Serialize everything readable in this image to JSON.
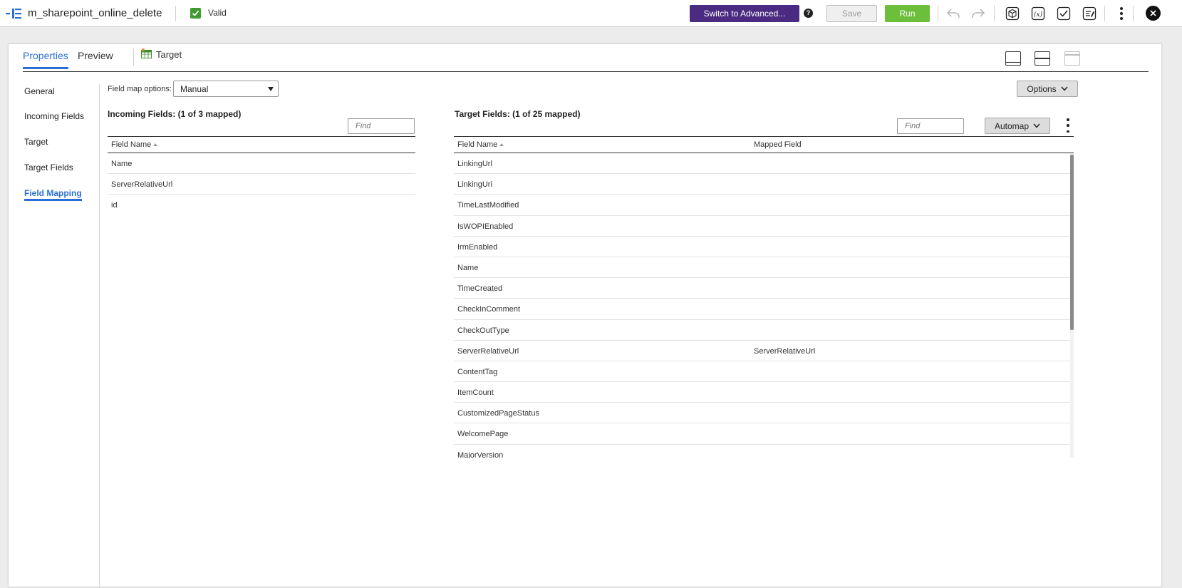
{
  "header": {
    "mapping_name": "m_sharepoint_online_delete",
    "status_label": "Valid",
    "switch_button": "Switch to Advanced...",
    "help": "?",
    "save_button": "Save",
    "run_button": "Run"
  },
  "colors": {
    "accent": "#2a6fd6",
    "advanced": "#4b2a82",
    "run": "#6bbf3a",
    "valid": "#3f9b2f"
  },
  "tabs": [
    {
      "label": "Properties",
      "active": true
    },
    {
      "label": "Preview",
      "active": false
    },
    {
      "label": "Target",
      "icon": "target-table-icon"
    }
  ],
  "sidebar": {
    "items": [
      {
        "label": "General"
      },
      {
        "label": "Incoming Fields"
      },
      {
        "label": "Target"
      },
      {
        "label": "Target Fields"
      },
      {
        "label": "Field Mapping",
        "active": true
      }
    ]
  },
  "field_map": {
    "label": "Field map options:",
    "selected": "Manual",
    "options_button": "Options"
  },
  "incoming": {
    "title": "Incoming Fields: (1 of 3 mapped)",
    "find_placeholder": "Find",
    "col_field_name": "Field Name",
    "rows": [
      "Name",
      "ServerRelativeUrl",
      "id"
    ]
  },
  "target": {
    "title": "Target Fields: (1 of 25 mapped)",
    "find_placeholder": "Find",
    "automap_button": "Automap",
    "col_field_name": "Field Name",
    "col_mapped_field": "Mapped Field",
    "rows": [
      {
        "name": "LinkingUrl",
        "mapped": ""
      },
      {
        "name": "LinkingUri",
        "mapped": ""
      },
      {
        "name": "TimeLastModified",
        "mapped": ""
      },
      {
        "name": "IsWOPIEnabled",
        "mapped": ""
      },
      {
        "name": "IrmEnabled",
        "mapped": ""
      },
      {
        "name": "Name",
        "mapped": ""
      },
      {
        "name": "TimeCreated",
        "mapped": ""
      },
      {
        "name": "CheckInComment",
        "mapped": ""
      },
      {
        "name": "CheckOutType",
        "mapped": ""
      },
      {
        "name": "ServerRelativeUrl",
        "mapped": "ServerRelativeUrl"
      },
      {
        "name": "ContentTag",
        "mapped": ""
      },
      {
        "name": "ItemCount",
        "mapped": ""
      },
      {
        "name": "CustomizedPageStatus",
        "mapped": ""
      },
      {
        "name": "WelcomePage",
        "mapped": ""
      },
      {
        "name": "MajorVersion",
        "mapped": ""
      }
    ]
  }
}
